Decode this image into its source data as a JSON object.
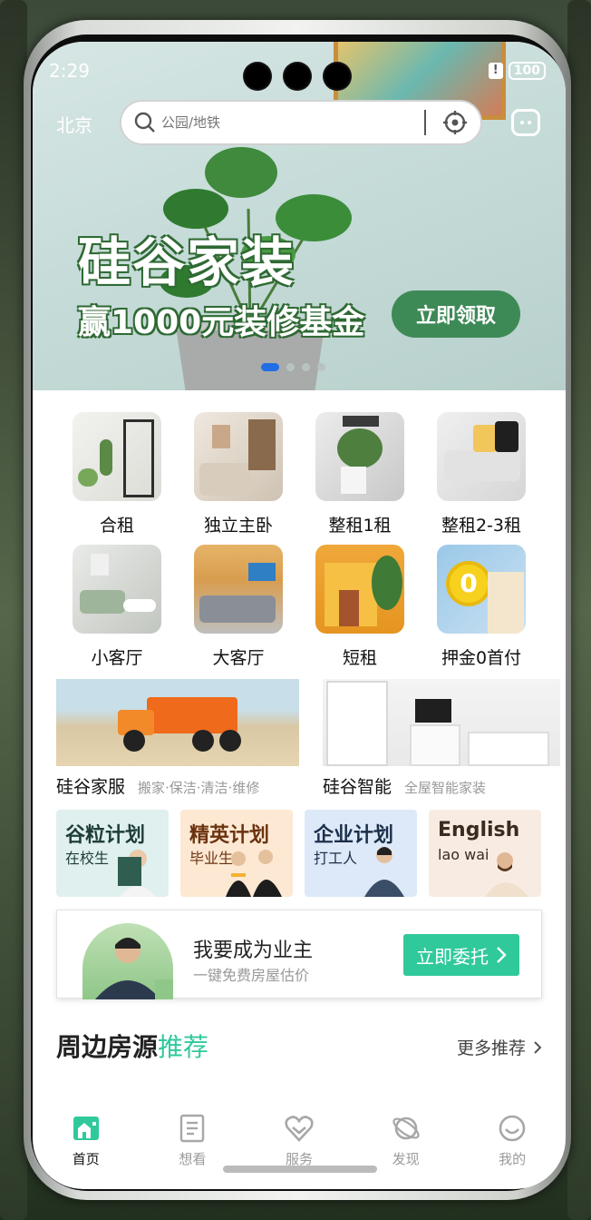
{
  "status_bar": {
    "time": "2:29",
    "battery": "100"
  },
  "top_bar": {
    "city": "北京",
    "search_placeholder": "公园/地铁"
  },
  "banner": {
    "title": "硅谷家装",
    "subtitle": "赢1000元装修基金",
    "button": "立即领取",
    "page_count": 4,
    "active_page": 1
  },
  "categories": [
    {
      "label": "合租",
      "icon": "shared-rent-photo"
    },
    {
      "label": "独立主卧",
      "icon": "master-bedroom-photo"
    },
    {
      "label": "整租1租",
      "icon": "whole-rent-1-photo"
    },
    {
      "label": "整租2-3租",
      "icon": "whole-rent-2-3-photo"
    },
    {
      "label": "小客厅",
      "icon": "small-living-room-photo"
    },
    {
      "label": "大客厅",
      "icon": "large-living-room-photo"
    },
    {
      "label": "短租",
      "icon": "short-rent-photo"
    },
    {
      "label": "押金0首付",
      "icon": "zero-deposit-photo"
    }
  ],
  "services": [
    {
      "title": "硅谷家服",
      "desc": "搬家·保洁·清洁·维修"
    },
    {
      "title": "硅谷智能",
      "desc": "全屋智能家装"
    }
  ],
  "plans": [
    {
      "title": "谷粒计划",
      "sub": "在校生",
      "bg": "#dff0ee",
      "color": "#1f3d3a"
    },
    {
      "title": "精英计划",
      "sub": "毕业生",
      "bg": "#fde8d3",
      "color": "#6b3310"
    },
    {
      "title": "企业计划",
      "sub": "打工人",
      "bg": "#dde9f8",
      "color": "#1c2f4a"
    },
    {
      "title": "English",
      "sub": "lao wai",
      "bg": "#f8ece2",
      "color": "#3a2a20"
    }
  ],
  "owner_card": {
    "title": "我要成为业主",
    "subtitle": "一键免费房屋估价",
    "button": "立即委托"
  },
  "section": {
    "title": "周边房源",
    "accent": "推荐",
    "more": "更多推荐"
  },
  "tabs": [
    {
      "label": "首页",
      "icon": "home-icon",
      "active": true
    },
    {
      "label": "想看",
      "icon": "document-icon",
      "active": false
    },
    {
      "label": "服务",
      "icon": "heart-hands-icon",
      "active": false
    },
    {
      "label": "发现",
      "icon": "planet-icon",
      "active": false
    },
    {
      "label": "我的",
      "icon": "smiley-icon",
      "active": false
    }
  ],
  "colors": {
    "accent": "#30c99c",
    "banner_button": "#3e8a57",
    "dot_active": "#1f6ee6"
  }
}
